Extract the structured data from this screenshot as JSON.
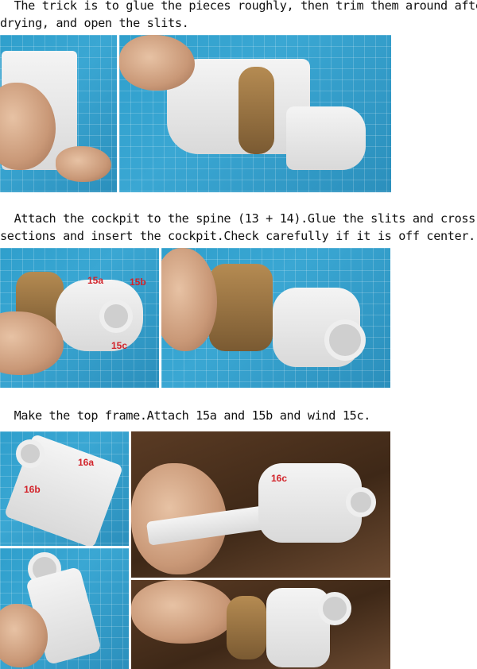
{
  "sections": [
    {
      "text": "  The trick is to glue the pieces roughly, then trim them around after\ndrying, and open the slits."
    },
    {
      "text": "  Attach the cockpit to the spine (13 + 14).Glue the slits and cross\nsections and insert the cockpit.Check carefully if it is off center."
    },
    {
      "text": "  Make the top frame.Attach 15a and 15b and wind 15c."
    }
  ],
  "photo_labels": {
    "p2a": [
      "15a",
      "15b",
      "15c"
    ],
    "p3a": [
      "16a",
      "16b"
    ],
    "p3b": [
      "16c"
    ]
  },
  "colors": {
    "mat_blue": "#2f9fcc",
    "label_red": "#d2232a",
    "background": "#ffffff"
  }
}
